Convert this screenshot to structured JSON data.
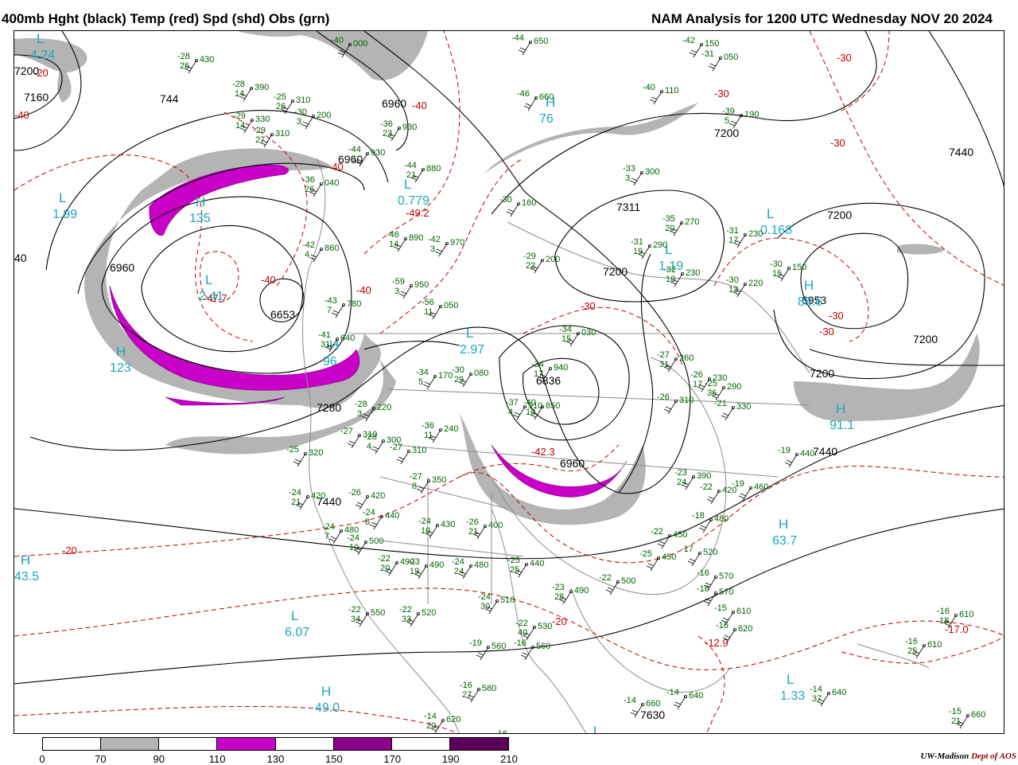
{
  "header": {
    "left_title": "400mb Hght (black) Temp (red) Spd (shd) Obs (grn)",
    "right_title": "NAM Analysis for 1200 UTC Wednesday  NOV 20 2024"
  },
  "legend": {
    "ticks": [
      "0",
      "70",
      "90",
      "110",
      "130",
      "150",
      "170",
      "190",
      "210"
    ],
    "colors": [
      "#ffffff",
      "#b4b4b4",
      "#ffffff",
      "#c800c8",
      "#ffffff",
      "#8c008c",
      "#ffffff",
      "#5a005a"
    ]
  },
  "credit": {
    "org": "UW-Madison",
    "dept": "Dept of AOS"
  },
  "colors": {
    "height": "#000000",
    "temperature": "#c00000",
    "speed_70_90": "#b4b4b4",
    "speed_110_130": "#c800c8",
    "observations": "#006400",
    "centers": "#1aa7c0",
    "borders": "#8c8c8c"
  },
  "height_labels": [
    "7200",
    "7160",
    "744",
    "6960",
    "6960",
    "6960",
    "7311",
    "7200",
    "7200",
    "7440",
    "7200",
    "6953",
    "7200",
    "7200",
    "6653",
    "6836",
    "6960",
    "7280",
    "7440",
    "7440",
    "7630",
    "40"
  ],
  "temp_labels": [
    "-30",
    "-30",
    "-40",
    "-30",
    "-40",
    "-49.2",
    "-47.7",
    "-40",
    "-40",
    "-30",
    "-30",
    "-20",
    "-20",
    "-42.3",
    "-30",
    "-20",
    "-12.9",
    "-17.0",
    "-40"
  ],
  "centers": [
    {
      "type": "L",
      "value": "4.24"
    },
    {
      "type": "L",
      "value": "1.99"
    },
    {
      "type": "L",
      "value": "0.779"
    },
    {
      "type": "H",
      "value": "135"
    },
    {
      "type": "L",
      "value": "2.41"
    },
    {
      "type": "H",
      "value": "123"
    },
    {
      "type": "L",
      "value": "2.97"
    },
    {
      "type": "L",
      "value": "1.19"
    },
    {
      "type": "L",
      "value": "0.168"
    },
    {
      "type": "H",
      "value": "88.6"
    },
    {
      "type": "H",
      "value": "91.1"
    },
    {
      "type": "H",
      "value": "63.7"
    },
    {
      "type": "H",
      "value": "43.5"
    },
    {
      "type": "L",
      "value": "6.07"
    },
    {
      "type": "H",
      "value": "49.0"
    },
    {
      "type": "L",
      "value": "1.33"
    },
    {
      "type": "L",
      "value": "1.07"
    },
    {
      "type": "H",
      "value": "96"
    },
    {
      "type": "H",
      "value": "76"
    }
  ],
  "observations": [
    {
      "t": "-28",
      "d": "26",
      "h": "430"
    },
    {
      "t": "-28",
      "d": "14",
      "h": "390"
    },
    {
      "t": "-25",
      "d": "26",
      "h": "310"
    },
    {
      "t": "-29",
      "d": "14",
      "h": "330"
    },
    {
      "t": "-29",
      "d": "27",
      "h": "310"
    },
    {
      "t": "-30",
      "d": "3",
      "h": "200"
    },
    {
      "t": "-36",
      "d": "23",
      "h": "930"
    },
    {
      "t": "-36",
      "d": "26",
      "h": "040"
    },
    {
      "t": "-44",
      "d": "21",
      "h": "880"
    },
    {
      "t": "-44",
      "d": "3",
      "h": "930"
    },
    {
      "t": "-46",
      "d": "14",
      "h": "890"
    },
    {
      "t": "-42",
      "d": "3",
      "h": "970"
    },
    {
      "t": "-42",
      "d": "4",
      "h": "860"
    },
    {
      "t": "-59",
      "d": "3",
      "h": "950"
    },
    {
      "t": "-56",
      "d": "11",
      "h": "050"
    },
    {
      "t": "-43",
      "d": "7",
      "h": "780"
    },
    {
      "t": "-41",
      "d": "31",
      "h": "640"
    },
    {
      "t": "-30",
      "d": "",
      "h": "160"
    },
    {
      "t": "-29",
      "d": "22",
      "h": "200"
    },
    {
      "t": "-33",
      "d": "3",
      "h": "300"
    },
    {
      "t": "-31",
      "d": "19",
      "h": "290"
    },
    {
      "t": "-35",
      "d": "20",
      "h": "270"
    },
    {
      "t": "-32",
      "d": "10",
      "h": "230"
    },
    {
      "t": "-31",
      "d": "17",
      "h": "230"
    },
    {
      "t": "-30",
      "d": "15",
      "h": "150"
    },
    {
      "t": "-30",
      "d": "13",
      "h": "220"
    },
    {
      "t": "-39",
      "d": "5",
      "h": "190"
    },
    {
      "t": "-40",
      "d": "",
      "h": "110"
    },
    {
      "t": "-34",
      "d": "15",
      "h": "030"
    },
    {
      "t": "-34",
      "d": "17",
      "h": "940"
    },
    {
      "t": "-37",
      "d": "4",
      "h": "910"
    },
    {
      "t": "-40",
      "d": "10",
      "h": "850"
    },
    {
      "t": "-34",
      "d": "5",
      "h": "170"
    },
    {
      "t": "-30",
      "d": "29",
      "h": "080"
    },
    {
      "t": "-36",
      "d": "11",
      "h": "240"
    },
    {
      "t": "-27",
      "d": "31",
      "h": "260"
    },
    {
      "t": "-26",
      "d": "17",
      "h": "230"
    },
    {
      "t": "-25",
      "d": "36",
      "h": "290"
    },
    {
      "t": "-26",
      "d": "",
      "h": "310"
    },
    {
      "t": "-21",
      "d": "",
      "h": "330"
    },
    {
      "t": "-28",
      "d": "3",
      "h": "220"
    },
    {
      "t": "-27",
      "d": "",
      "h": "310"
    },
    {
      "t": "-28",
      "d": "4",
      "h": "300"
    },
    {
      "t": "-27",
      "d": "",
      "h": "310"
    },
    {
      "t": "-25",
      "d": "",
      "h": "320"
    },
    {
      "t": "-24",
      "d": "21",
      "h": "420"
    },
    {
      "t": "-26",
      "d": "",
      "h": "420"
    },
    {
      "t": "-24",
      "d": "8",
      "h": "440"
    },
    {
      "t": "-27",
      "d": "8",
      "h": "350"
    },
    {
      "t": "-24",
      "d": "10",
      "h": "430"
    },
    {
      "t": "-26",
      "d": "21",
      "h": "400"
    },
    {
      "t": "-24",
      "d": "7",
      "h": "480"
    },
    {
      "t": "-24",
      "d": "10",
      "h": "500"
    },
    {
      "t": "-22",
      "d": "20",
      "h": "490"
    },
    {
      "t": "-23",
      "d": "19",
      "h": "490"
    },
    {
      "t": "-24",
      "d": "24",
      "h": "480"
    },
    {
      "t": "-25",
      "d": "25",
      "h": "440"
    },
    {
      "t": "-22",
      "d": "34",
      "h": "550"
    },
    {
      "t": "-22",
      "d": "33",
      "h": "520"
    },
    {
      "t": "-24",
      "d": "30",
      "h": "510"
    },
    {
      "t": "-22",
      "d": "40",
      "h": "530"
    },
    {
      "t": "-23",
      "d": "28",
      "h": "490"
    },
    {
      "t": "-22",
      "d": "",
      "h": "500"
    },
    {
      "t": "-25",
      "d": "",
      "h": "450"
    },
    {
      "t": "-22",
      "d": "",
      "h": "450"
    },
    {
      "t": "-23",
      "d": "24",
      "h": "390"
    },
    {
      "t": "-22",
      "d": "",
      "h": "420"
    },
    {
      "t": "-19",
      "d": "",
      "h": "460"
    },
    {
      "t": "-18",
      "d": "",
      "h": "480"
    },
    {
      "t": "-17",
      "d": "",
      "h": "520"
    },
    {
      "t": "-16",
      "d": "",
      "h": "570"
    },
    {
      "t": "-16",
      "d": "",
      "h": "570"
    },
    {
      "t": "-15",
      "d": "",
      "h": "610"
    },
    {
      "t": "-16",
      "d": "",
      "h": "620"
    },
    {
      "t": "-19",
      "d": "",
      "h": "440"
    },
    {
      "t": "-16",
      "d": "18",
      "h": "610"
    },
    {
      "t": "-16",
      "d": "25",
      "h": "610"
    },
    {
      "t": "-14",
      "d": "37",
      "h": "640"
    },
    {
      "t": "-14",
      "d": "",
      "h": "640"
    },
    {
      "t": "-14",
      "d": "",
      "h": "660"
    },
    {
      "t": "-15",
      "d": "21",
      "h": "660"
    },
    {
      "t": "-16",
      "d": "27",
      "h": "580"
    },
    {
      "t": "-14",
      "d": "20",
      "h": "620"
    },
    {
      "t": "-14",
      "d": "",
      "h": "630"
    },
    {
      "t": "-16",
      "d": "",
      "h": "600"
    },
    {
      "t": "-13",
      "d": "",
      "h": "630"
    },
    {
      "t": "-19",
      "d": "",
      "h": "560"
    },
    {
      "t": "-16",
      "d": "",
      "h": "560"
    },
    {
      "t": "-44",
      "d": "",
      "h": "650"
    },
    {
      "t": "-46",
      "d": "",
      "h": "660"
    },
    {
      "t": "-40",
      "d": "",
      "h": "000"
    },
    {
      "t": "-31",
      "d": "",
      "h": "050"
    },
    {
      "t": "-42",
      "d": "",
      "h": "150"
    }
  ]
}
